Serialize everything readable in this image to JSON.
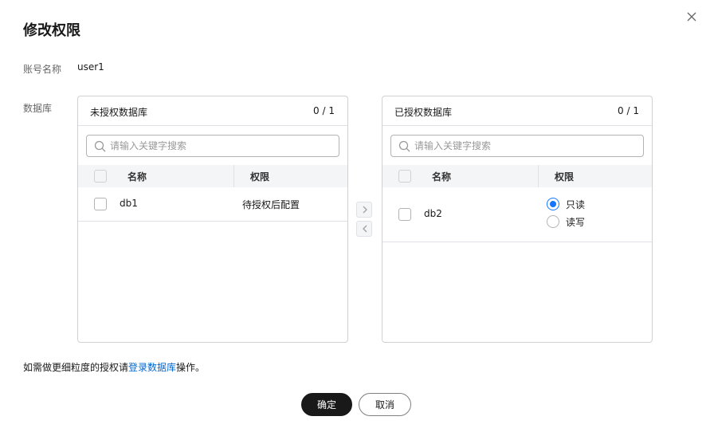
{
  "dialog": {
    "title": "修改权限",
    "account_label": "账号名称",
    "account_value": "user1",
    "database_label": "数据库"
  },
  "left_panel": {
    "title": "未授权数据库",
    "count": "0 / 1",
    "search_placeholder": "请输入关键字搜索",
    "columns": {
      "name": "名称",
      "permission": "权限"
    },
    "rows": [
      {
        "name": "db1",
        "permission": "待授权后配置",
        "checked": false
      }
    ]
  },
  "right_panel": {
    "title": "已授权数据库",
    "count": "0 / 1",
    "search_placeholder": "请输入关键字搜索",
    "columns": {
      "name": "名称",
      "permission": "权限"
    },
    "rows": [
      {
        "name": "db2",
        "checked": false,
        "options": [
          "只读",
          "读写"
        ],
        "selected": "只读"
      }
    ]
  },
  "hint": {
    "prefix": "如需做更细粒度的授权请",
    "link": "登录数据库",
    "suffix": "操作。"
  },
  "buttons": {
    "ok": "确定",
    "cancel": "取消"
  },
  "colors": {
    "accent": "#1476ff",
    "link": "#0067d1",
    "primary_button": "#191919"
  },
  "icons": {
    "close": "close-icon",
    "search": "search-icon",
    "move_right": "chevron-right-icon",
    "move_left": "chevron-left-icon"
  }
}
